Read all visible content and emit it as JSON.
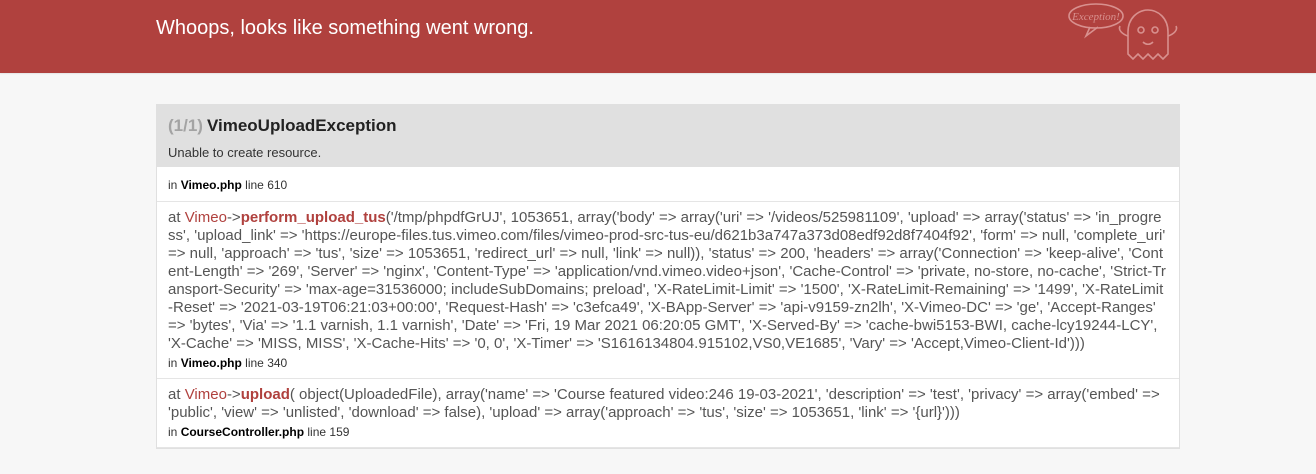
{
  "header": {
    "title": "Whoops, looks like something went wrong.",
    "mascot_text": "Exception!"
  },
  "exception": {
    "count": "(1/1)",
    "name": "VimeoUploadException",
    "message": "Unable to create resource.",
    "location": {
      "prefix": "in",
      "file": "Vimeo.php",
      "line_label": "line",
      "line": "610"
    }
  },
  "frames": [
    {
      "at": "at",
      "class": "Vimeo",
      "arrow": "->",
      "method": "perform_upload_tus",
      "args": "('/tmp/phpdfGrUJ', 1053651, array('body' => array('uri' => '/videos/525981109', 'upload' => array('status' => 'in_progress', 'upload_link' => 'https://europe-files.tus.vimeo.com/files/vimeo-prod-src-tus-eu/d621b3a747a373d08edf92d8f7404f92', 'form' => null, 'complete_uri' => null, 'approach' => 'tus', 'size' => 1053651, 'redirect_url' => null, 'link' => null)), 'status' => 200, 'headers' => array('Connection' => 'keep-alive', 'Content-Length' => '269', 'Server' => 'nginx', 'Content-Type' => 'application/vnd.vimeo.video+json', 'Cache-Control' => 'private, no-store, no-cache', 'Strict-Transport-Security' => 'max-age=31536000; includeSubDomains; preload', 'X-RateLimit-Limit' => '1500', 'X-RateLimit-Remaining' => '1499', 'X-RateLimit-Reset' => '2021-03-19T06:21:03+00:00', 'Request-Hash' => 'c3efca49', 'X-BApp-Server' => 'api-v9159-zn2lh', 'X-Vimeo-DC' => 'ge', 'Accept-Ranges' => 'bytes', 'Via' => '1.1 varnish, 1.1 varnish', 'Date' => 'Fri, 19 Mar 2021 06:20:05 GMT', 'X-Served-By' => 'cache-bwi5153-BWI, cache-lcy19244-LCY', 'X-Cache' => 'MISS, MISS', 'X-Cache-Hits' => '0, 0', 'X-Timer' => 'S1616134804.915102,VS0,VE1685', 'Vary' => 'Accept,Vimeo-Client-Id')))",
      "location": {
        "prefix": "in",
        "file": "Vimeo.php",
        "line_label": "line",
        "line": "340"
      }
    },
    {
      "at": "at",
      "class": "Vimeo",
      "arrow": "->",
      "method": "upload",
      "args": "( object(UploadedFile), array('name' => 'Course featured video:246 19-03-2021', 'description' => 'test', 'privacy' => array('embed' => 'public', 'view' => 'unlisted', 'download' => false), 'upload' => array('approach' => 'tus', 'size' => 1053651, 'link' => '{url}')))",
      "location": {
        "prefix": "in",
        "file": "CourseController.php",
        "line_label": "line",
        "line": "159"
      }
    }
  ]
}
